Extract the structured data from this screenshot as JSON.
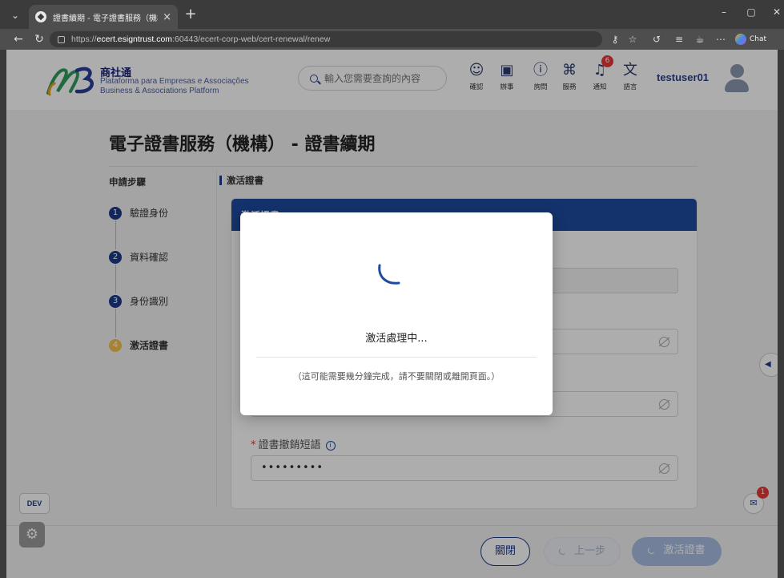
{
  "browser": {
    "tab_title": "證書續期 - 電子證書服務（機構）",
    "tab_close": "×",
    "new_tab": "+",
    "url_prefix": "https://",
    "url_host": "ecert.esigntrust.com",
    "url_path": ":60443/ecert-corp-web/cert-renewal/renew",
    "chat_label": "Chat"
  },
  "header": {
    "brand_cn": "商社通",
    "brand_pt": "Plataforma para Empresas e Associações",
    "brand_en": "Business & Associations Platform",
    "search_placeholder": "輸入您需要查詢的內容",
    "nav": [
      {
        "label": "確認",
        "icon": "confirm-icon"
      },
      {
        "label": "辦事",
        "icon": "services-briefcase-icon"
      },
      {
        "label": "詢問",
        "icon": "question-icon"
      },
      {
        "label": "服務",
        "icon": "grid-icon"
      },
      {
        "label": "通知",
        "icon": "bell-icon",
        "badge": "6"
      },
      {
        "label": "語言",
        "icon": "language-icon"
      }
    ],
    "username": "testuser01"
  },
  "page": {
    "title": "電子證書服務（機構） - 證書續期",
    "steps_heading": "申請步驟",
    "steps": [
      {
        "num": "1",
        "label": "驗證身份"
      },
      {
        "num": "2",
        "label": "資料確認"
      },
      {
        "num": "3",
        "label": "身份識別"
      },
      {
        "num": "4",
        "label": "激活證書"
      }
    ],
    "section_heading": "激活證書",
    "card_heading": "激活證書",
    "revoke_label": "證書撤銷短語",
    "revoke_required": "*",
    "revoke_value": "•••••••••"
  },
  "modal": {
    "message": "激活處理中...",
    "note": "（這可能需要幾分鐘完成，請不要關閉或離開頁面。）"
  },
  "footer": {
    "close_label": "關閉",
    "prev_label": "上一步",
    "activate_label": "激活證書"
  },
  "misc": {
    "dev_label": "DEV",
    "float_badge": "1"
  },
  "colors": {
    "primary": "#1e3a8a",
    "card_header": "#1e4aa0",
    "active_step": "#f5c04a",
    "badge": "#e53935"
  }
}
